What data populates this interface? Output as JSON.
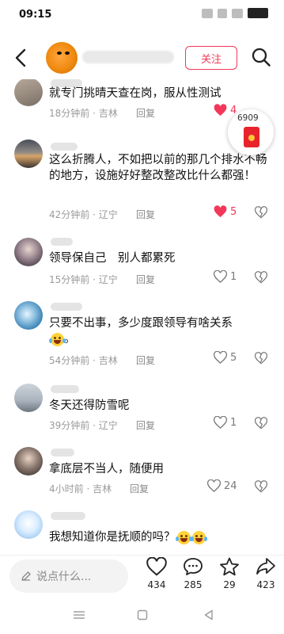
{
  "status": {
    "time": "09:15"
  },
  "header": {
    "follow_label": "关注"
  },
  "red_packet": {
    "count": "6909"
  },
  "comments": [
    {
      "text": "就专门挑晴天查在岗，服从性测试",
      "time": "18分钟前",
      "location": "吉林",
      "reply": "回复",
      "likes": "4",
      "liked": true
    },
    {
      "text": "这么折腾人，不如把以前的那几个排水不畅的地方，设施好好整改整改比什么都强！",
      "time": "42分钟前",
      "location": "辽宁",
      "reply": "回复",
      "likes": "5",
      "liked": true
    },
    {
      "text": "领导保自己　别人都累死",
      "time": "15分钟前",
      "location": "辽宁",
      "reply": "回复",
      "likes": "1",
      "liked": false
    },
    {
      "text": "只要不出事，多少度跟领导有啥关系",
      "time": "54分钟前",
      "location": "吉林",
      "reply": "回复",
      "likes": "5",
      "liked": false
    },
    {
      "text": "冬天还得防雪呢",
      "time": "39分钟前",
      "location": "辽宁",
      "reply": "回复",
      "likes": "1",
      "liked": false
    },
    {
      "text": "拿底层不当人，随便用",
      "time": "4小时前",
      "location": "吉林",
      "reply": "回复",
      "likes": "24",
      "liked": false
    },
    {
      "text": "我想知道你是抚顺的吗？",
      "time": "",
      "location": "",
      "reply": "",
      "likes": "",
      "liked": false
    }
  ],
  "bottom": {
    "placeholder": "说点什么...",
    "likes": "434",
    "comments": "285",
    "favorites": "29",
    "shares": "423"
  },
  "icons": {
    "back": "chevron-left-icon",
    "search": "search-icon",
    "heart": "heart-icon",
    "dislike": "broken-heart-icon",
    "comment": "comment-icon",
    "star": "star-icon",
    "share": "share-icon",
    "pen": "pen-icon"
  },
  "colors": {
    "accent": "#f2385a",
    "meta": "#9a9a9a",
    "red_packet": "#e8232b"
  }
}
